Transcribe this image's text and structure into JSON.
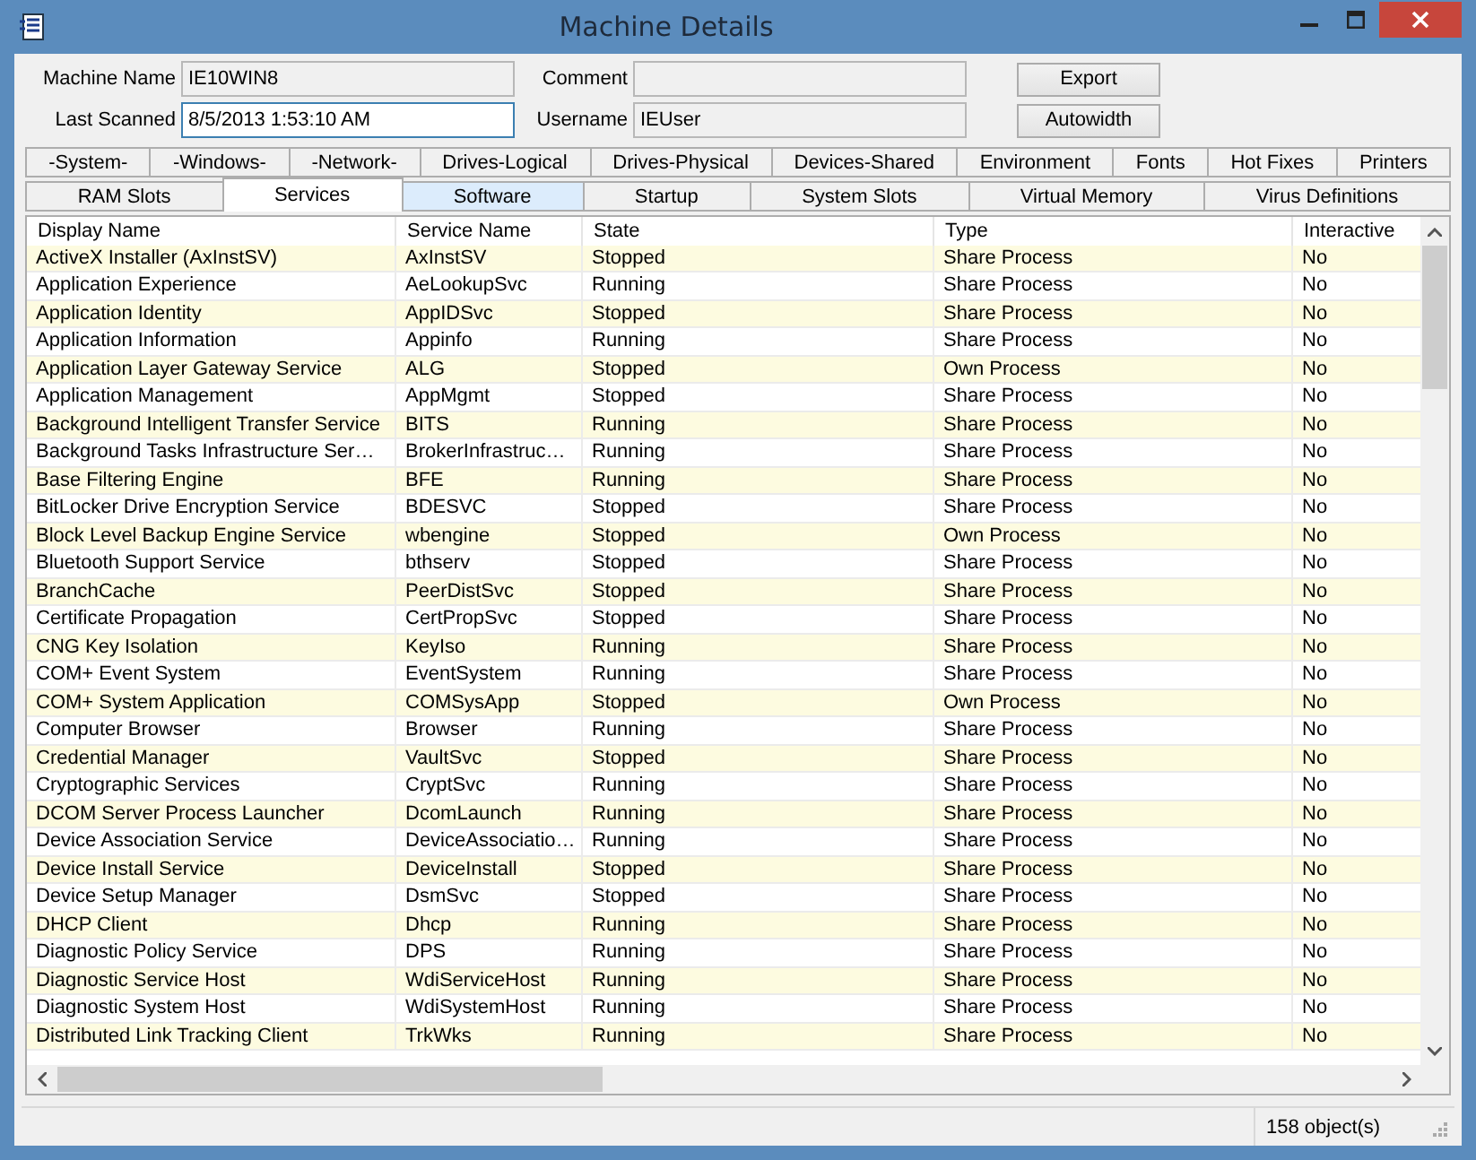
{
  "window": {
    "title": "Machine Details"
  },
  "fields": [
    {
      "label": "Machine Name",
      "value": "IE10WIN8",
      "focused": false
    },
    {
      "label": "Comment",
      "focused": false
    },
    {
      "label": "Last Scanned",
      "value": "8/5/2013 1:53:10 AM",
      "focused": true
    },
    {
      "label": "Username",
      "value": "IEUser",
      "focused": false
    }
  ],
  "buttons": [
    "Export",
    "Autowidth"
  ],
  "tab_rows": [
    [
      {
        "label": "-System-",
        "selected": false,
        "hovered": false
      },
      {
        "label": "-Windows-",
        "selected": false,
        "hovered": false
      },
      {
        "label": "-Network-",
        "selected": false,
        "hovered": false
      },
      {
        "label": "Drives-Logical",
        "selected": false,
        "hovered": false
      },
      {
        "label": "Drives-Physical",
        "selected": false,
        "hovered": false
      },
      {
        "label": "Devices-Shared",
        "selected": false,
        "hovered": false
      },
      {
        "label": "Environment",
        "selected": false,
        "hovered": false
      },
      {
        "label": "Fonts",
        "selected": false,
        "hovered": false
      },
      {
        "label": "Hot Fixes",
        "selected": false,
        "hovered": false
      },
      {
        "label": "Printers",
        "selected": false,
        "hovered": false
      }
    ],
    [
      {
        "label": "RAM Slots",
        "selected": false,
        "hovered": false
      },
      {
        "label": "Services",
        "selected": true,
        "hovered": false
      },
      {
        "label": "Software",
        "selected": false,
        "hovered": true
      },
      {
        "label": "Startup",
        "selected": false,
        "hovered": false
      },
      {
        "label": "System Slots",
        "selected": false,
        "hovered": false
      },
      {
        "label": "Virtual Memory",
        "selected": false,
        "hovered": false
      },
      {
        "label": "Virus Definitions",
        "selected": false,
        "hovered": false
      }
    ]
  ],
  "table": {
    "columns": [
      "Display Name",
      "Service Name",
      "State",
      "Type",
      "Interactive"
    ],
    "rows": [
      [
        "ActiveX Installer (AxInstSV)",
        "AxInstSV",
        "Stopped",
        "Share Process",
        "No"
      ],
      [
        "Application Experience",
        "AeLookupSvc",
        "Running",
        "Share Process",
        "No"
      ],
      [
        "Application Identity",
        "AppIDSvc",
        "Stopped",
        "Share Process",
        "No"
      ],
      [
        "Application Information",
        "Appinfo",
        "Running",
        "Share Process",
        "No"
      ],
      [
        "Application Layer Gateway Service",
        "ALG",
        "Stopped",
        "Own Process",
        "No"
      ],
      [
        "Application Management",
        "AppMgmt",
        "Stopped",
        "Share Process",
        "No"
      ],
      [
        "Background Intelligent Transfer Service",
        "BITS",
        "Running",
        "Share Process",
        "No"
      ],
      [
        "Background Tasks Infrastructure Ser…",
        "BrokerInfrastruc…",
        "Running",
        "Share Process",
        "No"
      ],
      [
        "Base Filtering Engine",
        "BFE",
        "Running",
        "Share Process",
        "No"
      ],
      [
        "BitLocker Drive Encryption Service",
        "BDESVC",
        "Stopped",
        "Share Process",
        "No"
      ],
      [
        "Block Level Backup Engine Service",
        "wbengine",
        "Stopped",
        "Own Process",
        "No"
      ],
      [
        "Bluetooth Support Service",
        "bthserv",
        "Stopped",
        "Share Process",
        "No"
      ],
      [
        "BranchCache",
        "PeerDistSvc",
        "Stopped",
        "Share Process",
        "No"
      ],
      [
        "Certificate Propagation",
        "CertPropSvc",
        "Stopped",
        "Share Process",
        "No"
      ],
      [
        "CNG Key Isolation",
        "KeyIso",
        "Running",
        "Share Process",
        "No"
      ],
      [
        "COM+ Event System",
        "EventSystem",
        "Running",
        "Share Process",
        "No"
      ],
      [
        "COM+ System Application",
        "COMSysApp",
        "Stopped",
        "Own Process",
        "No"
      ],
      [
        "Computer Browser",
        "Browser",
        "Running",
        "Share Process",
        "No"
      ],
      [
        "Credential Manager",
        "VaultSvc",
        "Stopped",
        "Share Process",
        "No"
      ],
      [
        "Cryptographic Services",
        "CryptSvc",
        "Running",
        "Share Process",
        "No"
      ],
      [
        "DCOM Server Process Launcher",
        "DcomLaunch",
        "Running",
        "Share Process",
        "No"
      ],
      [
        "Device Association Service",
        "DeviceAssociatio…",
        "Running",
        "Share Process",
        "No"
      ],
      [
        "Device Install Service",
        "DeviceInstall",
        "Stopped",
        "Share Process",
        "No"
      ],
      [
        "Device Setup Manager",
        "DsmSvc",
        "Stopped",
        "Share Process",
        "No"
      ],
      [
        "DHCP Client",
        "Dhcp",
        "Running",
        "Share Process",
        "No"
      ],
      [
        "Diagnostic Policy Service",
        "DPS",
        "Running",
        "Share Process",
        "No"
      ],
      [
        "Diagnostic Service Host",
        "WdiServiceHost",
        "Running",
        "Share Process",
        "No"
      ],
      [
        "Diagnostic System Host",
        "WdiSystemHost",
        "Running",
        "Share Process",
        "No"
      ],
      [
        "Distributed Link Tracking Client",
        "TrkWks",
        "Running",
        "Share Process",
        "No"
      ]
    ]
  },
  "status_bar": {
    "count": "158 object(s)"
  }
}
